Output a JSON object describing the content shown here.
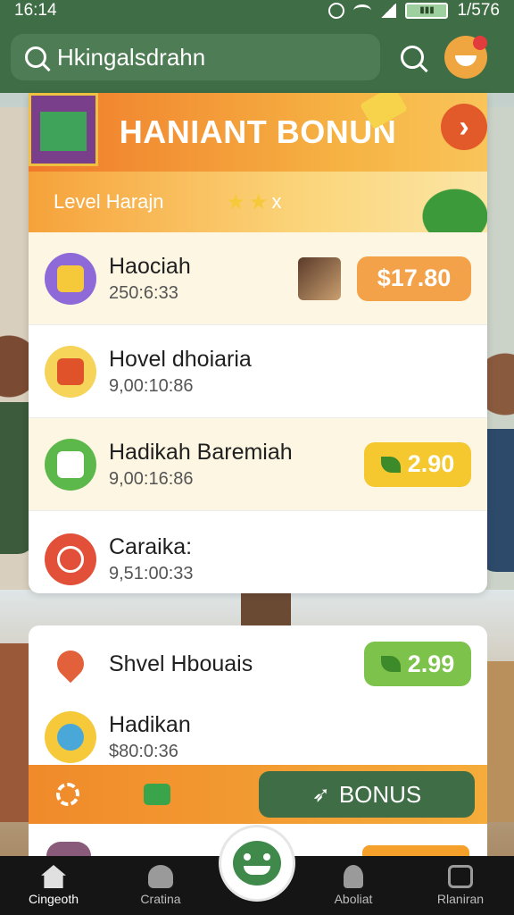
{
  "status_bar": {
    "time": "16:14",
    "battery_text": "▮▮▮",
    "clock_right": "1/576"
  },
  "header": {
    "search_text": "Hkingalsdrahn"
  },
  "banner": {
    "title": "HANIANT BONUN",
    "level_label": "Level Harajn",
    "stars_suffix": "x"
  },
  "rows": [
    {
      "title": "Haociah",
      "time": "250:6:33",
      "amount": "$17.80",
      "icon": "gift-icon"
    },
    {
      "title": "Hovel dhoiaria",
      "time": "9,00:10:86",
      "amount": "",
      "icon": "ticket-icon"
    },
    {
      "title": "Hadikah Baremiah",
      "time": "9,00:16:86",
      "amount": "2.90",
      "icon": "envelope-icon"
    },
    {
      "title": "Caraika:",
      "time": "9,51:00:33",
      "amount": "",
      "icon": "target-icon"
    }
  ],
  "card2_rows": [
    {
      "title": "Shvel Hbouais",
      "amount": "2.99",
      "icon": "heart-icon"
    },
    {
      "title": "Hadikan",
      "time": "$80:0:36",
      "icon": "basket-icon"
    }
  ],
  "action_bar": {
    "bonus_label": "BONUS"
  },
  "nav": [
    {
      "label": "Cingeoth"
    },
    {
      "label": "Cratina"
    },
    {
      "label": "Aboliat"
    },
    {
      "label": "Rlaniran"
    }
  ],
  "colors": {
    "brand_green": "#3f6e46",
    "accent_orange": "#f4a24a",
    "accent_yellow": "#f5c830",
    "accent_lime": "#7dc24a"
  }
}
